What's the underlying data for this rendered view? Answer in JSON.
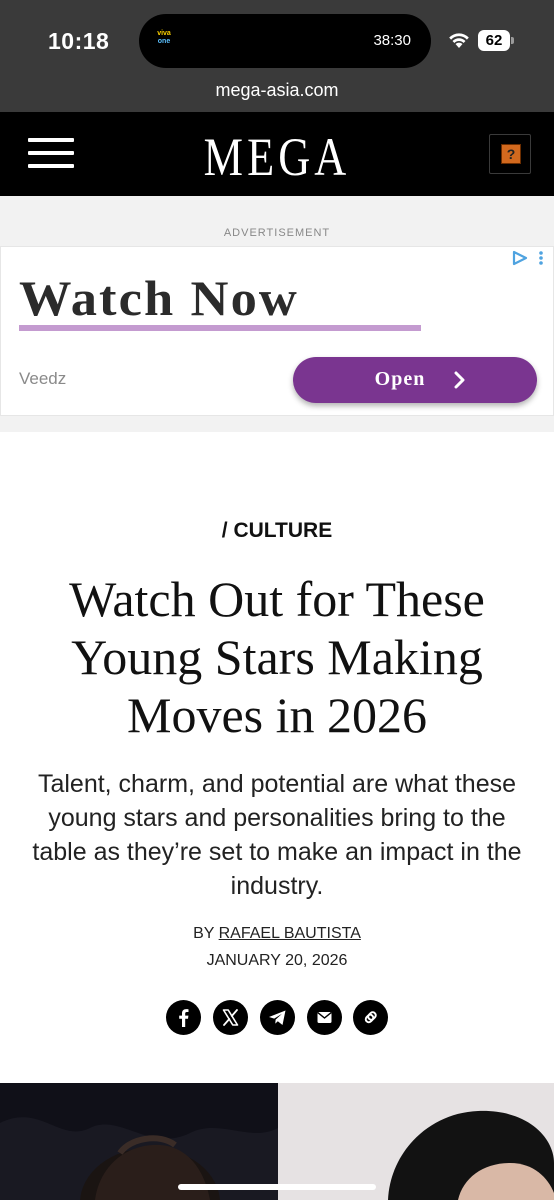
{
  "status_bar": {
    "time": "10:18",
    "island_app": [
      "viva",
      "one"
    ],
    "island_timer": "38:30",
    "battery": "62"
  },
  "browser": {
    "url": "mega-asia.com"
  },
  "site_header": {
    "logo": "MEGA",
    "badge_glyph": "?"
  },
  "ad": {
    "label": "ADVERTISEMENT",
    "headline": "Watch Now",
    "brand": "Veedz",
    "button_label": "Open",
    "accent_color": "#7a3590",
    "underline_color": "#c49bd0"
  },
  "article": {
    "category": "/ CULTURE",
    "headline": "Watch Out for These Young Stars Making Moves in 2026",
    "dek": "Talent, charm, and potential are what these young stars and personalities bring to the table as they’re set to make an impact in the industry.",
    "byline_prefix": "BY",
    "author": "RAFAEL BAUTISTA",
    "date": "JANUARY 20, 2026"
  },
  "share": {
    "icons": [
      "facebook-icon",
      "x-icon",
      "telegram-icon",
      "email-icon",
      "link-icon"
    ]
  }
}
